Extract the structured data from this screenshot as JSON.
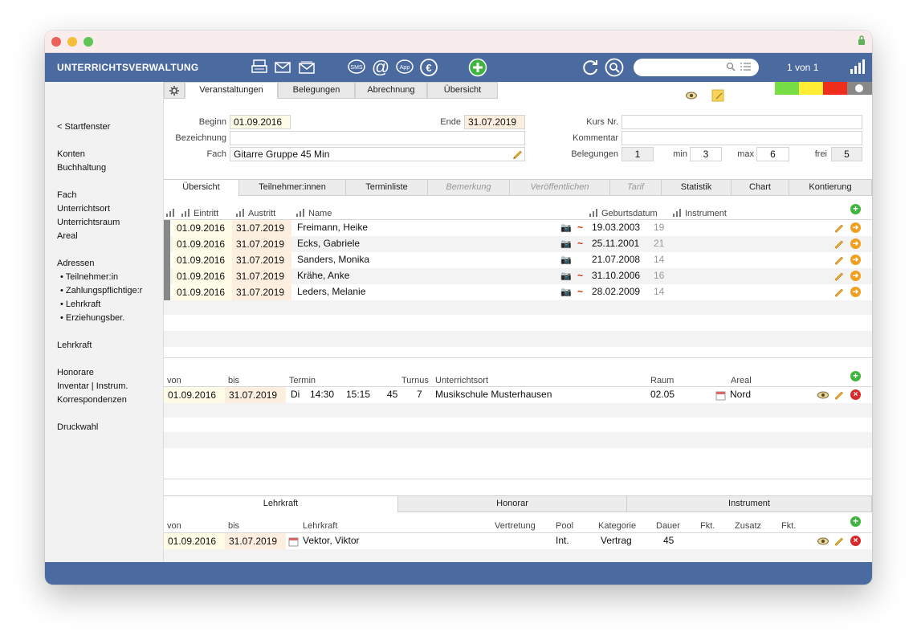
{
  "app": {
    "title": "UNTERRICHTSVERWALTUNG",
    "pager": "1 von 1",
    "search_placeholder": ""
  },
  "toolbar_icons": [
    "printer-icon",
    "envelope-icon",
    "envelope-stack-icon",
    "sms-icon",
    "at-icon",
    "app-icon",
    "euro-icon",
    "add-icon",
    "refresh-icon",
    "search-icon"
  ],
  "sidebar": {
    "items": [
      "< Startfenster",
      "Konten",
      "Buchhaltung",
      "Fach",
      "Unterrichtsort",
      "Unterrichtsraum",
      "Areal",
      "Adressen",
      "• Teilnehmer:in",
      "• Zahlungspflichtige:r",
      "• Lehrkraft",
      "• Erziehungsber.",
      "Lehrkraft",
      "Honorare",
      "Inventar | Instrum.",
      "Korrespondenzen",
      "Druckwahl"
    ]
  },
  "top_tabs": [
    "Veranstaltungen",
    "Belegungen",
    "Abrechnung",
    "Übersicht"
  ],
  "status_colors": [
    "#77dd44",
    "#ffee33",
    "#ee2d1d",
    "#888888"
  ],
  "form": {
    "beginn_label": "Beginn",
    "beginn": "01.09.2016",
    "ende_label": "Ende",
    "ende": "31.07.2019",
    "bezeichnung_label": "Bezeichnung",
    "bezeichnung": "",
    "fach_label": "Fach",
    "fach": "Gitarre Gruppe 45 Min",
    "kurs_label": "Kurs Nr.",
    "kurs": "",
    "kommentar_label": "Kommentar",
    "kommentar": "",
    "belegungen_label": "Belegungen",
    "belegungen": "1",
    "min_label": "min",
    "min": "3",
    "max_label": "max",
    "max": "6",
    "frei_label": "frei",
    "frei": "5"
  },
  "sub_tabs": [
    "Übersicht",
    "Teilnehmer:innen",
    "Terminliste",
    "Bemerkung",
    "Veröffentlichen",
    "Tarif",
    "Statistik",
    "Chart",
    "Kontierung"
  ],
  "participants": {
    "headers": [
      "Eintritt",
      "Austritt",
      "Name",
      "Geburtsdatum",
      "Instrument"
    ],
    "rows": [
      {
        "eintritt": "01.09.2016",
        "austritt": "31.07.2019",
        "name": "Freimann, Heike",
        "mark": "~",
        "geburt": "19.03.2003",
        "alter": "19"
      },
      {
        "eintritt": "01.09.2016",
        "austritt": "31.07.2019",
        "name": "Ecks, Gabriele",
        "mark": "~",
        "geburt": "25.11.2001",
        "alter": "21"
      },
      {
        "eintritt": "01.09.2016",
        "austritt": "31.07.2019",
        "name": "Sanders, Monika",
        "mark": "",
        "geburt": "21.07.2008",
        "alter": "14"
      },
      {
        "eintritt": "01.09.2016",
        "austritt": "31.07.2019",
        "name": "Krähe, Anke",
        "mark": "~",
        "geburt": "31.10.2006",
        "alter": "16"
      },
      {
        "eintritt": "01.09.2016",
        "austritt": "31.07.2019",
        "name": "Leders, Melanie",
        "mark": "~",
        "geburt": "28.02.2009",
        "alter": "14"
      }
    ]
  },
  "schedule": {
    "headers": [
      "von",
      "bis",
      "Termin",
      "Turnus",
      "Unterrichtsort",
      "Raum",
      "Areal"
    ],
    "row": {
      "von": "01.09.2016",
      "bis": "31.07.2019",
      "tag": "Di",
      "start": "14:30",
      "end": "15:15",
      "dauer": "45",
      "turnus": "7",
      "ort": "Musikschule Musterhausen",
      "raum": "02.05",
      "areal": "Nord"
    }
  },
  "bottom_tabs": [
    "Lehrkraft",
    "Honorar",
    "Instrument"
  ],
  "teacher": {
    "headers": [
      "von",
      "bis",
      "Lehrkraft",
      "Vertretung",
      "Pool",
      "Kategorie",
      "Dauer",
      "Fkt.",
      "Zusatz",
      "Fkt."
    ],
    "row": {
      "von": "01.09.2016",
      "bis": "31.07.2019",
      "lehrkraft": "Vektor, Viktor",
      "pool": "Int.",
      "kategorie": "Vertrag",
      "dauer": "45"
    }
  }
}
